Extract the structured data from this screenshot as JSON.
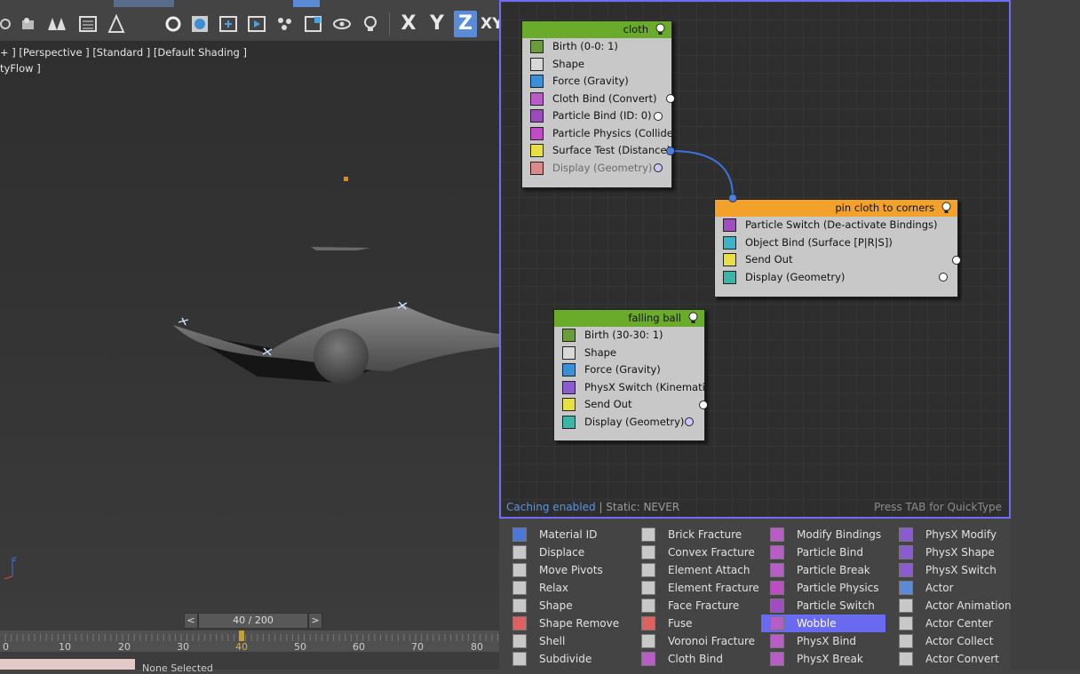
{
  "toolbar": {
    "axes": [
      "X",
      "Y",
      "Z",
      "XY"
    ]
  },
  "viewport": {
    "label": "+ ] [Perspective ] [Standard ] [Default Shading ]",
    "sublabel": "tyFlow ]",
    "gizmo_z": "z"
  },
  "timeline": {
    "prev": "<",
    "next": ">",
    "frame": "40 / 200",
    "ticks": [
      "0",
      "10",
      "20",
      "30",
      "40",
      "50",
      "60",
      "70",
      "80"
    ],
    "status": "None Selected"
  },
  "editor": {
    "status_cache": "Caching enabled",
    "status_static": " | Static: NEVER",
    "status_hint": "Press TAB for QuickType",
    "nodes": [
      {
        "title": "cloth",
        "operators": [
          {
            "label": "Birth (0-0: 1)",
            "icon_color": "#6b9c3c",
            "icon": "birth-icon"
          },
          {
            "label": "Shape",
            "icon_color": "#d8d8d8",
            "icon": "shape-icon"
          },
          {
            "label": "Force (Gravity)",
            "icon_color": "#3b8fd6",
            "icon": "force-icon"
          },
          {
            "label": "Cloth Bind (Convert)",
            "icon_color": "#b85cc7",
            "icon": "cloth-bind-icon"
          },
          {
            "label": "Particle Bind (ID: 0)",
            "icon_color": "#9a4cb8",
            "icon": "particle-bind-icon"
          },
          {
            "label": "Particle Physics (Collide...",
            "icon_color": "#c04cc4",
            "icon": "particle-physics-icon"
          },
          {
            "label": "Surface Test (Distance)",
            "icon_color": "#e8e040",
            "icon": "surface-test-icon"
          },
          {
            "label": "Display (Geometry)",
            "icon_color": "#d98a8a",
            "icon": "display-icon"
          }
        ]
      },
      {
        "title": "pin cloth to corners",
        "operators": [
          {
            "label": "Particle Switch (De-activate Bindings)",
            "icon_color": "#a24cc4",
            "icon": "particle-switch-icon"
          },
          {
            "label": "Object Bind (Surface [P|R|S])",
            "icon_color": "#3bb4c8",
            "icon": "object-bind-icon"
          },
          {
            "label": "Send Out",
            "icon_color": "#e8e040",
            "icon": "send-out-icon"
          },
          {
            "label": "Display (Geometry)",
            "icon_color": "#3cb4a8",
            "icon": "display-icon"
          }
        ]
      },
      {
        "title": "falling ball",
        "operators": [
          {
            "label": "Birth (30-30: 1)",
            "icon_color": "#6b9c3c",
            "icon": "birth-icon"
          },
          {
            "label": "Shape",
            "icon_color": "#d8d8d8",
            "icon": "shape-icon"
          },
          {
            "label": "Force (Gravity)",
            "icon_color": "#3b8fd6",
            "icon": "force-icon"
          },
          {
            "label": "PhysX Switch (Kinematic)",
            "icon_color": "#8a5cd0",
            "icon": "physx-switch-icon"
          },
          {
            "label": "Send Out",
            "icon_color": "#e8e040",
            "icon": "send-out-icon"
          },
          {
            "label": "Display (Geometry)",
            "icon_color": "#3cb4a8",
            "icon": "display-icon"
          }
        ]
      }
    ]
  },
  "palette": {
    "selected": "Wobble",
    "columns": [
      [
        {
          "label": "Material ID",
          "icon_color": "#4a78d8",
          "icon": "material-id-icon"
        },
        {
          "label": "Displace",
          "icon_color": "#c8c8c8",
          "icon": "displace-icon"
        },
        {
          "label": "Move Pivots",
          "icon_color": "#c8c8c8",
          "icon": "move-pivots-icon"
        },
        {
          "label": "Relax",
          "icon_color": "#c8c8c8",
          "icon": "relax-icon"
        },
        {
          "label": "Shape",
          "icon_color": "#c8c8c8",
          "icon": "shape-icon"
        },
        {
          "label": "Shape Remove",
          "icon_color": "#e06060",
          "icon": "shape-remove-icon"
        },
        {
          "label": "Shell",
          "icon_color": "#c8c8c8",
          "icon": "shell-icon"
        },
        {
          "label": "Subdivide",
          "icon_color": "#c8c8c8",
          "icon": "subdivide-icon"
        }
      ],
      [
        {
          "label": "Brick Fracture",
          "icon_color": "#c8c8c8",
          "icon": "brick-fracture-icon"
        },
        {
          "label": "Convex Fracture",
          "icon_color": "#c8c8c8",
          "icon": "convex-fracture-icon"
        },
        {
          "label": "Element Attach",
          "icon_color": "#c8c8c8",
          "icon": "element-attach-icon"
        },
        {
          "label": "Element Fracture",
          "icon_color": "#c8c8c8",
          "icon": "element-fracture-icon"
        },
        {
          "label": "Face Fracture",
          "icon_color": "#c8c8c8",
          "icon": "face-fracture-icon"
        },
        {
          "label": "Fuse",
          "icon_color": "#e06060",
          "icon": "fuse-icon"
        },
        {
          "label": "Voronoi Fracture",
          "icon_color": "#c8c8c8",
          "icon": "voronoi-fracture-icon"
        },
        {
          "label": "Cloth Bind",
          "icon_color": "#b85cc7",
          "icon": "cloth-bind-icon"
        }
      ],
      [
        {
          "label": "Modify Bindings",
          "icon_color": "#b85cc7",
          "icon": "modify-bindings-icon"
        },
        {
          "label": "Particle Bind",
          "icon_color": "#b85cc7",
          "icon": "particle-bind-icon"
        },
        {
          "label": "Particle Break",
          "icon_color": "#b85cc7",
          "icon": "particle-break-icon"
        },
        {
          "label": "Particle Physics",
          "icon_color": "#c04cc4",
          "icon": "particle-physics-icon"
        },
        {
          "label": "Particle Switch",
          "icon_color": "#a24cc4",
          "icon": "particle-switch-icon"
        },
        {
          "label": "Wobble",
          "icon_color": "#b85cc7",
          "icon": "wobble-icon"
        },
        {
          "label": "PhysX Bind",
          "icon_color": "#b85cc7",
          "icon": "physx-bind-icon"
        },
        {
          "label": "PhysX Break",
          "icon_color": "#b85cc7",
          "icon": "physx-break-icon"
        }
      ],
      [
        {
          "label": "PhysX Modify",
          "icon_color": "#8a5cd0",
          "icon": "physx-modify-icon"
        },
        {
          "label": "PhysX Shape",
          "icon_color": "#8a5cd0",
          "icon": "physx-shape-icon"
        },
        {
          "label": "PhysX Switch",
          "icon_color": "#8a5cd0",
          "icon": "physx-switch-icon"
        },
        {
          "label": "Actor",
          "icon_color": "#5b8bd6",
          "icon": "actor-icon"
        },
        {
          "label": "Actor Animation",
          "icon_color": "#c8c8c8",
          "icon": "actor-animation-icon"
        },
        {
          "label": "Actor Center",
          "icon_color": "#c8c8c8",
          "icon": "actor-center-icon"
        },
        {
          "label": "Actor Collect",
          "icon_color": "#c8c8c8",
          "icon": "actor-collect-icon"
        },
        {
          "label": "Actor Convert",
          "icon_color": "#c8c8c8",
          "icon": "actor-convert-icon"
        }
      ]
    ]
  }
}
